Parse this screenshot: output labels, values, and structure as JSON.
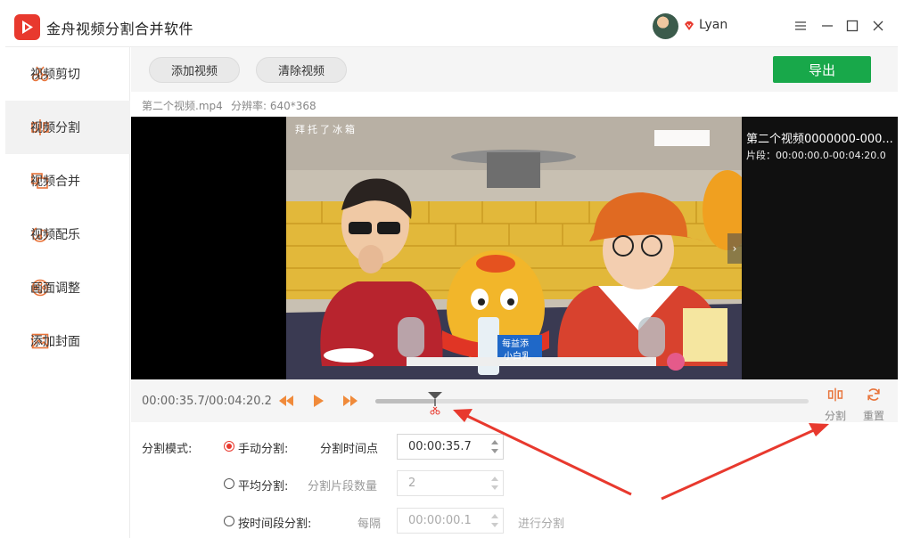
{
  "app": {
    "title": "金舟视频分割合并软件",
    "username": "Lyan"
  },
  "sidebar": {
    "items": [
      {
        "label": "视频剪切",
        "icon": "scissors-icon"
      },
      {
        "label": "视频分割",
        "icon": "split-icon",
        "active": true
      },
      {
        "label": "视频合并",
        "icon": "merge-icon"
      },
      {
        "label": "视频配乐",
        "icon": "music-icon"
      },
      {
        "label": "画面调整",
        "icon": "film-reel-icon"
      },
      {
        "label": "添加封面",
        "icon": "image-icon"
      }
    ]
  },
  "toolbar": {
    "add_label": "添加视频",
    "clear_label": "清除视频",
    "export_label": "导出"
  },
  "fileinfo": {
    "filename": "第二个视频.mp4",
    "resolution": "分辨率: 640*368"
  },
  "video": {
    "caption": "拜托了冰箱",
    "brand_text_1": "每益添",
    "brand_text_2": "小白乳"
  },
  "playlist": {
    "title": "第二个视频0000000-000...",
    "segment": "片段：00:00:00.0-00:04:20.0"
  },
  "controls": {
    "time": "00:00:35.7/00:04:20.2",
    "progress_percent": 13.7,
    "split_label": "分割",
    "reset_label": "重置"
  },
  "settings": {
    "mode_label": "分割模式:",
    "manual": {
      "label": "手动分割:",
      "field_label": "分割时间点",
      "value": "00:00:35.7",
      "selected": true
    },
    "average": {
      "label": "平均分割:",
      "field_label": "分割片段数量",
      "value": "2"
    },
    "interval": {
      "label": "按时间段分割:",
      "field_label": "每隔",
      "value": "00:00:00.1",
      "action": "进行分割"
    }
  },
  "colors": {
    "accent": "#e8392e",
    "export": "#18a84a",
    "icon": "#e8743b"
  }
}
